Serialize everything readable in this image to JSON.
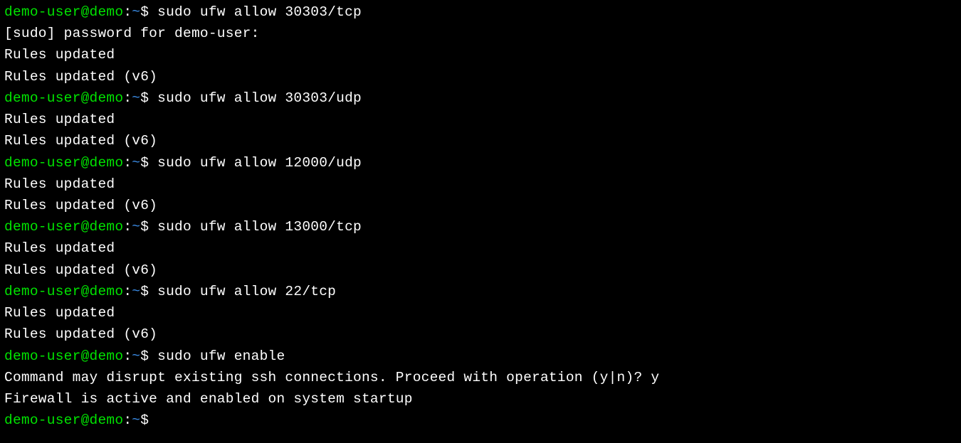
{
  "prompt": {
    "user_host": "demo-user@demo",
    "colon": ":",
    "path": "~",
    "dollar": "$"
  },
  "lines": [
    {
      "type": "prompt",
      "command": "sudo ufw allow 30303/tcp"
    },
    {
      "type": "output",
      "text": "[sudo] password for demo-user:"
    },
    {
      "type": "output",
      "text": "Rules updated"
    },
    {
      "type": "output",
      "text": "Rules updated (v6)"
    },
    {
      "type": "prompt",
      "command": "sudo ufw allow 30303/udp"
    },
    {
      "type": "output",
      "text": "Rules updated"
    },
    {
      "type": "output",
      "text": "Rules updated (v6)"
    },
    {
      "type": "prompt",
      "command": "sudo ufw allow 12000/udp"
    },
    {
      "type": "output",
      "text": "Rules updated"
    },
    {
      "type": "output",
      "text": "Rules updated (v6)"
    },
    {
      "type": "prompt",
      "command": "sudo ufw allow 13000/tcp"
    },
    {
      "type": "output",
      "text": "Rules updated"
    },
    {
      "type": "output",
      "text": "Rules updated (v6)"
    },
    {
      "type": "prompt",
      "command": "sudo ufw allow 22/tcp"
    },
    {
      "type": "output",
      "text": "Rules updated"
    },
    {
      "type": "output",
      "text": "Rules updated (v6)"
    },
    {
      "type": "prompt",
      "command": "sudo ufw enable"
    },
    {
      "type": "output",
      "text": "Command may disrupt existing ssh connections. Proceed with operation (y|n)? y"
    },
    {
      "type": "output",
      "text": "Firewall is active and enabled on system startup"
    },
    {
      "type": "prompt",
      "command": ""
    }
  ]
}
